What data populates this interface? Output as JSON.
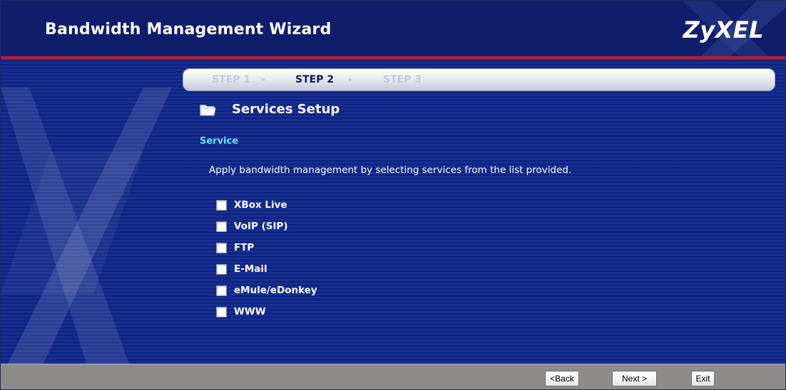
{
  "header": {
    "title": "Bandwidth Management Wizard",
    "brand": "ZyXEL"
  },
  "steps": {
    "items": [
      "STEP 1",
      "STEP 2",
      "STEP 3"
    ],
    "current": "STEP 2",
    "separator": "▸"
  },
  "section": {
    "title": "Services Setup",
    "icon": "folder-icon"
  },
  "service": {
    "heading": "Service",
    "description": "Apply bandwidth management by selecting services from the list provided.",
    "items": [
      {
        "label": "XBox Live",
        "checked": false
      },
      {
        "label": "VoIP (SIP)",
        "checked": false
      },
      {
        "label": "FTP",
        "checked": false
      },
      {
        "label": "E-Mail",
        "checked": false
      },
      {
        "label": "eMule/eDonkey",
        "checked": false
      },
      {
        "label": "WWW",
        "checked": false
      }
    ]
  },
  "buttons": {
    "back": "<Back",
    "next": "Next >",
    "exit": "Exit"
  },
  "colors": {
    "header_bg": "#0f1d6b",
    "content_bg": "#0f2687",
    "accent_red": "#b22033",
    "subheading": "#66e4ff",
    "footer_bg": "#8e8c8a"
  }
}
